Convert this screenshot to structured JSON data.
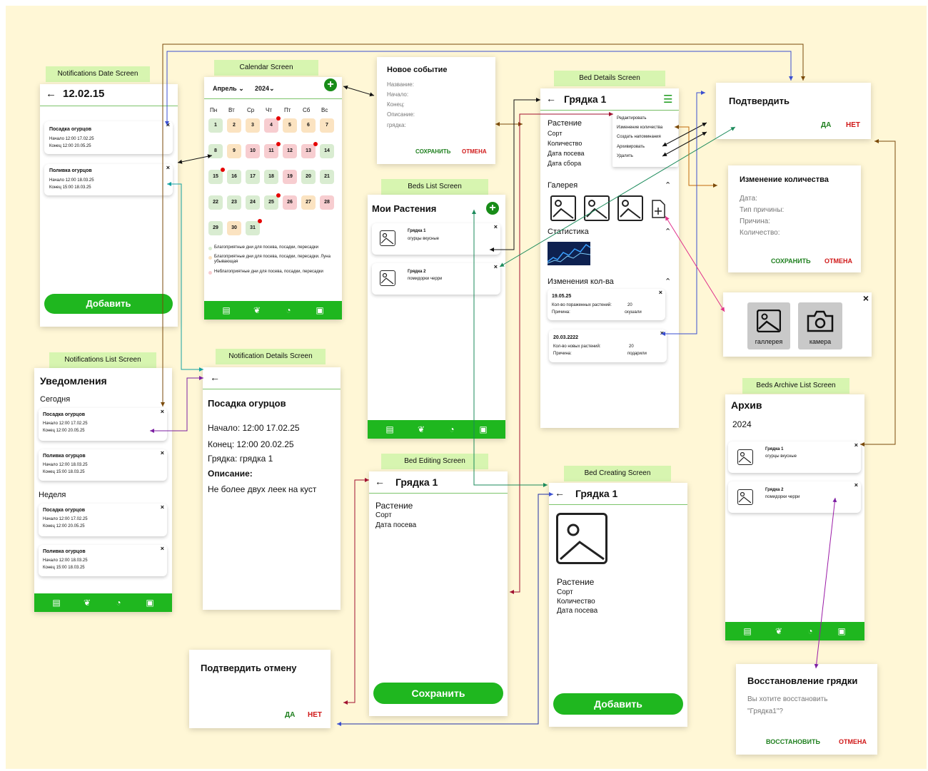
{
  "tags": {
    "notif_date": "Notifications Date Screen",
    "calendar": "Calendar Screen",
    "bed_details": "Bed Details Screen",
    "beds_list": "Beds List Screen",
    "notif_list": "Notifications List Screen",
    "notif_details": "Notification Details Screen",
    "bed_editing": "Bed Editing Screen",
    "bed_creating": "Bed Creating Screen",
    "beds_archive": "Beds Archive List Screen"
  },
  "notif_date": {
    "back": "←",
    "title": "12.02.15",
    "cards": [
      {
        "title": "Посадка огурцов",
        "start": "Начало 12:00 17.02.25",
        "end": "Конец   12:00 20.05.25",
        "close": "×"
      },
      {
        "title": "Поливка огурцов",
        "start": "Начало 12:00 18.03.25",
        "end": "Конец   15:00 18.03.25",
        "close": "×"
      }
    ],
    "add_button": "Добавить"
  },
  "calendar": {
    "month": "Апрель",
    "year": "2024",
    "chev": "⌄",
    "weekdays": [
      "Пн",
      "Вт",
      "Ср",
      "Чт",
      "Пт",
      "Сб",
      "Вс"
    ],
    "days": [
      {
        "n": "1",
        "c": "g"
      },
      {
        "n": "2",
        "c": "o"
      },
      {
        "n": "3",
        "c": "o"
      },
      {
        "n": "4",
        "c": "r",
        "dot": true
      },
      {
        "n": "5",
        "c": "o"
      },
      {
        "n": "6",
        "c": "o"
      },
      {
        "n": "7",
        "c": "o"
      },
      {
        "n": "8",
        "c": "g"
      },
      {
        "n": "9",
        "c": "o"
      },
      {
        "n": "10",
        "c": "r"
      },
      {
        "n": "11",
        "c": "r",
        "dot": true
      },
      {
        "n": "12",
        "c": "r"
      },
      {
        "n": "13",
        "c": "r",
        "dot": true
      },
      {
        "n": "14",
        "c": "g"
      },
      {
        "n": "15",
        "c": "g",
        "dot": true
      },
      {
        "n": "16",
        "c": "g"
      },
      {
        "n": "17",
        "c": "g"
      },
      {
        "n": "18",
        "c": "g"
      },
      {
        "n": "19",
        "c": "r"
      },
      {
        "n": "20",
        "c": "g"
      },
      {
        "n": "21",
        "c": "g"
      },
      {
        "n": "22",
        "c": "g"
      },
      {
        "n": "23",
        "c": "g"
      },
      {
        "n": "24",
        "c": "g"
      },
      {
        "n": "25",
        "c": "g",
        "dot": true
      },
      {
        "n": "26",
        "c": "r"
      },
      {
        "n": "27",
        "c": "o"
      },
      {
        "n": "28",
        "c": "r"
      },
      {
        "n": "29",
        "c": "g"
      },
      {
        "n": "30",
        "c": "o"
      },
      {
        "n": "31",
        "c": "g",
        "dot": true
      }
    ],
    "legend": [
      {
        "text": "Благоприятные дни для посева, посадки, пересадки",
        "color": "#d9ecd1"
      },
      {
        "text": "Благоприятные дни для посева, посадки, пересадки. Луна убывающая",
        "color": "#fbe3c1"
      },
      {
        "text": "Неблагоприятные дни для посева, посадки, пересадки",
        "color": "#f7cdd0"
      }
    ],
    "colors": {
      "g": "#d9ecd1",
      "o": "#fbe3c1",
      "r": "#f7cdd0"
    }
  },
  "new_event": {
    "title": "Новое событие",
    "fields": [
      "Название:",
      "Начало:",
      "Конец:",
      "Описание:",
      "грядка:"
    ],
    "save": "СОХРАНИТЬ",
    "cancel": "ОТМЕНА"
  },
  "bed_details": {
    "back": "←",
    "title": "Грядка 1",
    "fields": [
      "Растение",
      "Сорт",
      "Количество",
      "Дата посева",
      "Дата сбора"
    ],
    "menu": [
      "Редактировать",
      "Изменение количества",
      "Создать напоминания",
      "Архивировать",
      "Удалить"
    ],
    "gallery": "Галерея",
    "stats": "Статистика",
    "changes": "Изменения кол-ва",
    "change_cards": [
      {
        "date": "19.05.25",
        "l1": "Кол-во пораженных растений:",
        "v1": "20",
        "l2": "Причина:",
        "v2": "скушали"
      },
      {
        "date": "20.03.2222",
        "l1": "Кол-во новых растений:",
        "v1": "20",
        "l2": "Причина:",
        "v2": "подарили"
      }
    ],
    "caret": "^",
    "close": "×"
  },
  "confirm": {
    "title": "Подтвердить",
    "yes": "ДА",
    "no": "НЕТ"
  },
  "qty_change": {
    "title": "Изменение количества",
    "fields": [
      "Дата:",
      "Тип причины:",
      "Причина:",
      "Количество:"
    ],
    "save": "СОХРАНИТЬ",
    "cancel": "ОТМЕНА"
  },
  "photo_picker": {
    "gallery": "галлерея",
    "camera": "камера",
    "close": "×"
  },
  "beds_list": {
    "title": "Мои Растения",
    "items": [
      {
        "name": "Грядка 1",
        "desc": "огурцы вкусные"
      },
      {
        "name": "Грядка 2",
        "desc": "помидорки черри"
      }
    ],
    "close": "×"
  },
  "notif_list": {
    "title": "Уведомления",
    "today": "Сегодня",
    "week": "Неделя",
    "cards": [
      {
        "title": "Посадка огурцов",
        "start": "Начало 12:00 17.02.25",
        "end": "Конец   12:00 20.05.25"
      },
      {
        "title": "Поливка огурцов",
        "start": "Начало 12:00 18.03.25",
        "end": "Конец   15:00 18.03.25"
      },
      {
        "title": "Посадка огурцов",
        "start": "Начало 12:00 17.02.25",
        "end": "Конец   12:00 20.05.25"
      },
      {
        "title": "Поливка огурцов",
        "start": "Начало 12:00 18.03.25",
        "end": "Конец   15:00 18.03.25"
      }
    ],
    "close": "×"
  },
  "notif_details": {
    "back": "←",
    "title": "Посадка огурцов",
    "start": "Начало: 12:00 17.02.25",
    "end": "Конец: 12:00 20.02.25",
    "bed": "Грядка: грядка 1",
    "desc_label": "Описание:",
    "desc": "Не более двух леек на куст"
  },
  "bed_editing": {
    "back": "←",
    "title": "Грядка 1",
    "fields": [
      "Растение",
      "Сорт",
      "Дата посева"
    ],
    "save": "Сохранить"
  },
  "bed_creating": {
    "back": "←",
    "title": "Грядка 1",
    "fields": [
      "Растение",
      "Сорт",
      "Количество",
      "Дата посева"
    ],
    "add": "Добавить"
  },
  "confirm_cancel": {
    "title": "Подтвердить отмену",
    "yes": "ДА",
    "no": "НЕТ"
  },
  "archive": {
    "title": "Архив",
    "year": "2024",
    "items": [
      {
        "name": "Грядка 1",
        "desc": "огурцы вкусные"
      },
      {
        "name": "Грядка 2",
        "desc": "помидорки черри"
      }
    ],
    "close": "×"
  },
  "restore": {
    "title": "Восстановление грядки",
    "text1": "Вы хотите восстановить",
    "text2": "\"Грядка1\"?",
    "restore": "ВОССТАНОВИТЬ",
    "cancel": "ОТМЕНА"
  },
  "colors": {
    "green": "#1fb71f",
    "board": "#fff7d6",
    "tag": "#d7f5b0"
  }
}
